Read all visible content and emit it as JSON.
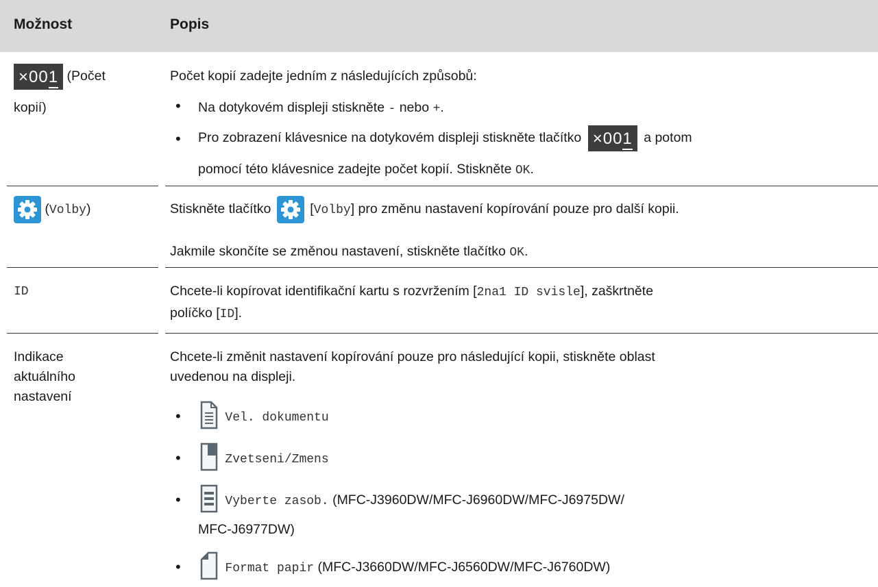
{
  "header": {
    "col1": "Možnost",
    "col2": "Popis"
  },
  "rows": {
    "copies": {
      "counter": "×001",
      "counter_prefix": "×",
      "counter_digits_main": "00",
      "counter_digits_last": "1",
      "label_line1": "(Počet",
      "label_line2": "kopií)",
      "intro": "Počet kopií zadejte jedním z následujících způsobů:",
      "b1_pre": "Na dotykovém displeji stiskněte ",
      "b1_minus": "-",
      "b1_mid": " nebo ",
      "b1_plus": "+",
      "b1_post": ".",
      "b2_pre": "Pro zobrazení klávesnice na dotykovém displeji stiskněte tlačítko",
      "b2_post": "a potom",
      "b2_line2_pre": "pomocí této klávesnice zadejte počet kopií. Stiskněte ",
      "b2_ok": "OK",
      "b2_line2_post": "."
    },
    "options": {
      "label": "(Volby)",
      "label_mono": "Volby",
      "p1_pre": "Stiskněte tlačítko",
      "p1_bracket_open": "[",
      "p1_mono": "Volby",
      "p1_post": "] pro změnu nastavení kopírování pouze pro další kopii.",
      "p2_pre": "Jakmile skončíte se změnou nastavení, stiskněte tlačítko ",
      "p2_ok": "OK",
      "p2_post": "."
    },
    "id": {
      "label": "ID",
      "line1_pre": "Chcete-li kopírovat identifikační kartu s rozvržením [",
      "line1_mono": "2na1 ID svisle",
      "line1_post": "], zaškrtněte",
      "line2_pre": "políčko [",
      "line2_mono": "ID",
      "line2_post": "]."
    },
    "current": {
      "label_lines": [
        "Indikace",
        "aktuálního",
        "nastavení"
      ],
      "intro_line1": "Chcete-li změnit nastavení kopírování pouze pro následující kopii, stiskněte oblast",
      "intro_line2": "uvedenou na displeji.",
      "items": [
        {
          "mono": "Vel. dokumentu",
          "note": "",
          "icon": "document-size-icon"
        },
        {
          "mono": "Zvetseni/Zmens",
          "note": "",
          "icon": "enlarge-reduce-icon"
        },
        {
          "mono": "Vyberte zasob.",
          "note": " (MFC-J3960DW/MFC-J6960DW/MFC-J6975DW/",
          "note2": "MFC-J6977DW)",
          "icon": "tray-select-icon"
        },
        {
          "mono": "Format papir",
          "note": " (MFC-J3660DW/MFC-J6560DW/MFC-J6760DW)",
          "icon": "paper-format-icon"
        }
      ]
    }
  },
  "colors": {
    "header_bg": "#d9d9d9",
    "gear_blue": "#2e95d4",
    "counter_bg": "#3d3d3f",
    "icon_grey": "#5a6770"
  }
}
